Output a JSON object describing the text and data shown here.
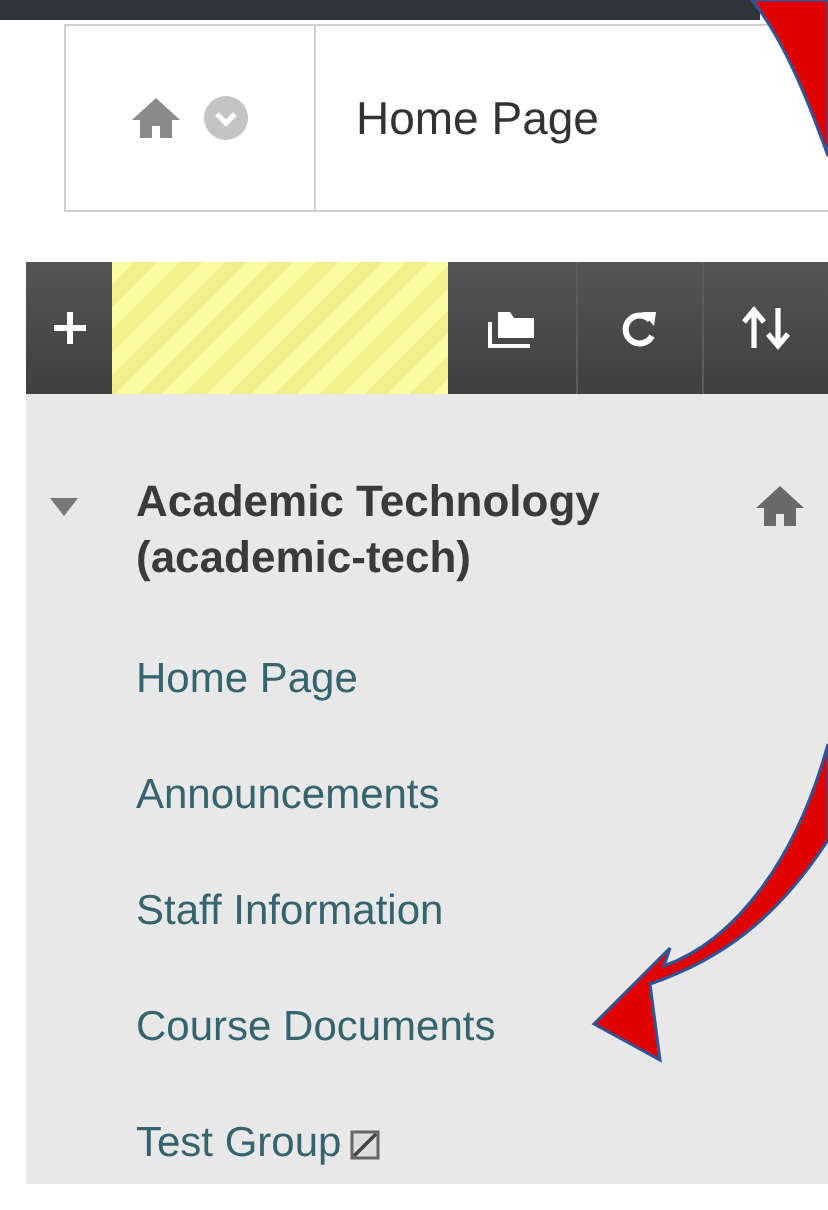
{
  "breadcrumb": {
    "title": "Home Page"
  },
  "course_menu": {
    "title": "Academic Technology (academic-tech)",
    "expanded": true,
    "items": [
      {
        "label": "Home Page",
        "unavailable": false
      },
      {
        "label": "Announcements",
        "unavailable": false
      },
      {
        "label": "Staff Information",
        "unavailable": false
      },
      {
        "label": "Course Documents",
        "unavailable": false
      },
      {
        "label": "Test Group",
        "unavailable": true
      }
    ]
  }
}
